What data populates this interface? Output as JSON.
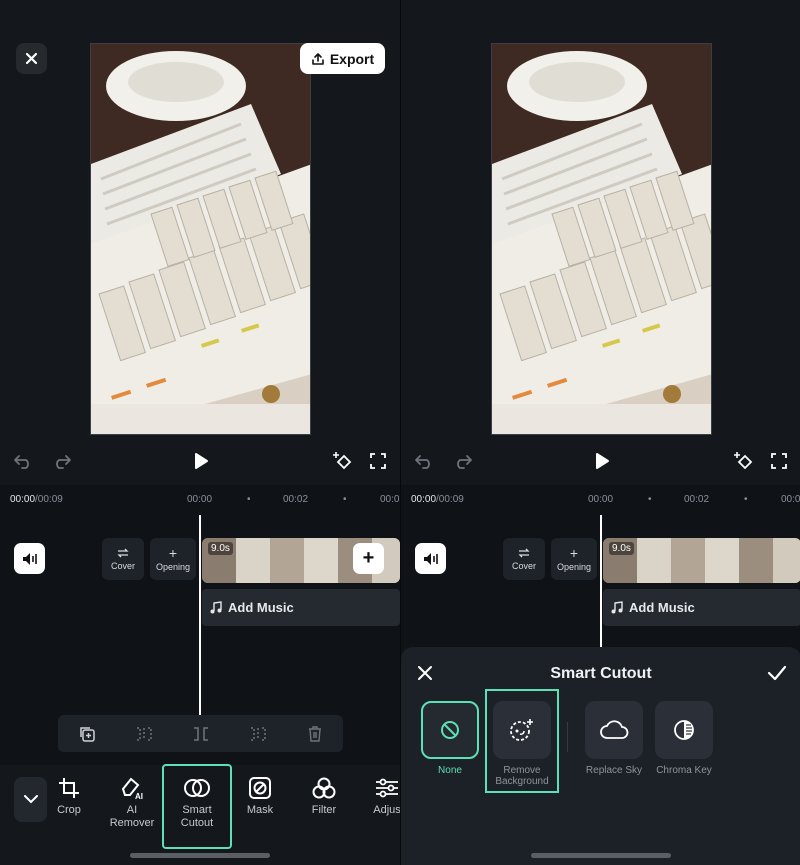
{
  "left": {
    "preview": {
      "close_icon": "close-icon",
      "export_label": "Export"
    },
    "timeline": {
      "current_time": "00:00",
      "total_time": "/00:09",
      "ticks": [
        "00:00",
        "•",
        "00:02",
        "•",
        "00:0"
      ],
      "cover_label": "Cover",
      "opening_label": "Opening",
      "clip_duration": "9.0s",
      "add_music_label": "Add Music"
    },
    "toolbar": {
      "tools": [
        {
          "label": "Crop",
          "icon": "crop-icon"
        },
        {
          "label": "AI\nRemover",
          "icon": "ai-eraser-icon"
        },
        {
          "label": "Smart\nCutout",
          "icon": "smart-cutout-icon"
        },
        {
          "label": "Mask",
          "icon": "mask-icon"
        },
        {
          "label": "Filter",
          "icon": "filter-icon"
        },
        {
          "label": "Adjus",
          "icon": "adjust-icon"
        }
      ]
    }
  },
  "right": {
    "timeline": {
      "current_time": "00:00",
      "total_time": "/00:09",
      "ticks": [
        "00:00",
        "•",
        "00:02",
        "•",
        "00:0"
      ],
      "cover_label": "Cover",
      "opening_label": "Opening",
      "clip_duration": "9.0s",
      "add_music_label": "Add Music"
    },
    "smart_cutout": {
      "title": "Smart Cutout",
      "options": [
        {
          "label": "None",
          "icon": "none-icon",
          "selected": true
        },
        {
          "label": "Remove\nBackground",
          "icon": "remove-background-icon",
          "selected": false
        },
        {
          "label": "Replace Sky",
          "icon": "cloud-icon",
          "selected": false
        },
        {
          "label": "Chroma Key",
          "icon": "chroma-key-icon",
          "selected": false
        }
      ]
    }
  },
  "colors": {
    "accent": "#5de0b5",
    "background": "#14181d",
    "panel": "#1c2127"
  }
}
